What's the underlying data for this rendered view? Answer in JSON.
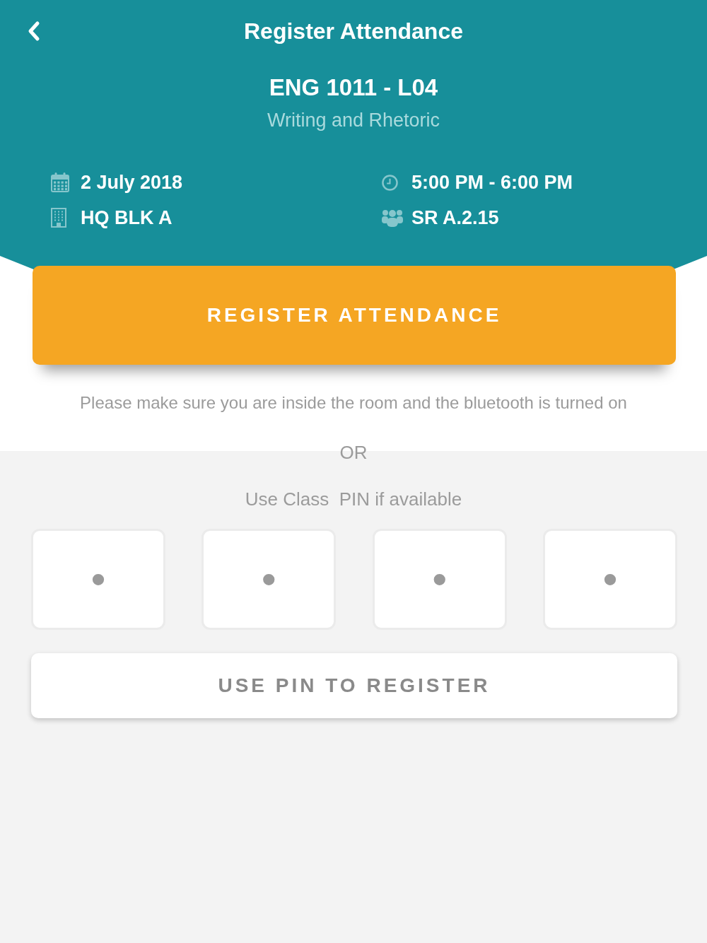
{
  "header": {
    "title": "Register Attendance"
  },
  "course": {
    "code": "ENG 1011 - L04",
    "name": "Writing and Rhetoric"
  },
  "details": [
    {
      "kind": "date",
      "text": "2 July 2018"
    },
    {
      "kind": "time",
      "text": "5:00 PM - 6:00 PM"
    },
    {
      "kind": "building",
      "text": "HQ BLK A"
    },
    {
      "kind": "room",
      "text": "SR A.2.15"
    }
  ],
  "register_button": "REGISTER ATTENDANCE",
  "notice": "Please make sure you are inside the room and the bluetooth is turned on",
  "separator": "OR",
  "pin_prompt": "Use Class  PIN if available",
  "pin_fields": [
    {
      "placeholder": "•"
    },
    {
      "placeholder": "•"
    },
    {
      "placeholder": "•"
    },
    {
      "placeholder": "•"
    }
  ],
  "pin_button": "USE PIN TO REGISTER"
}
